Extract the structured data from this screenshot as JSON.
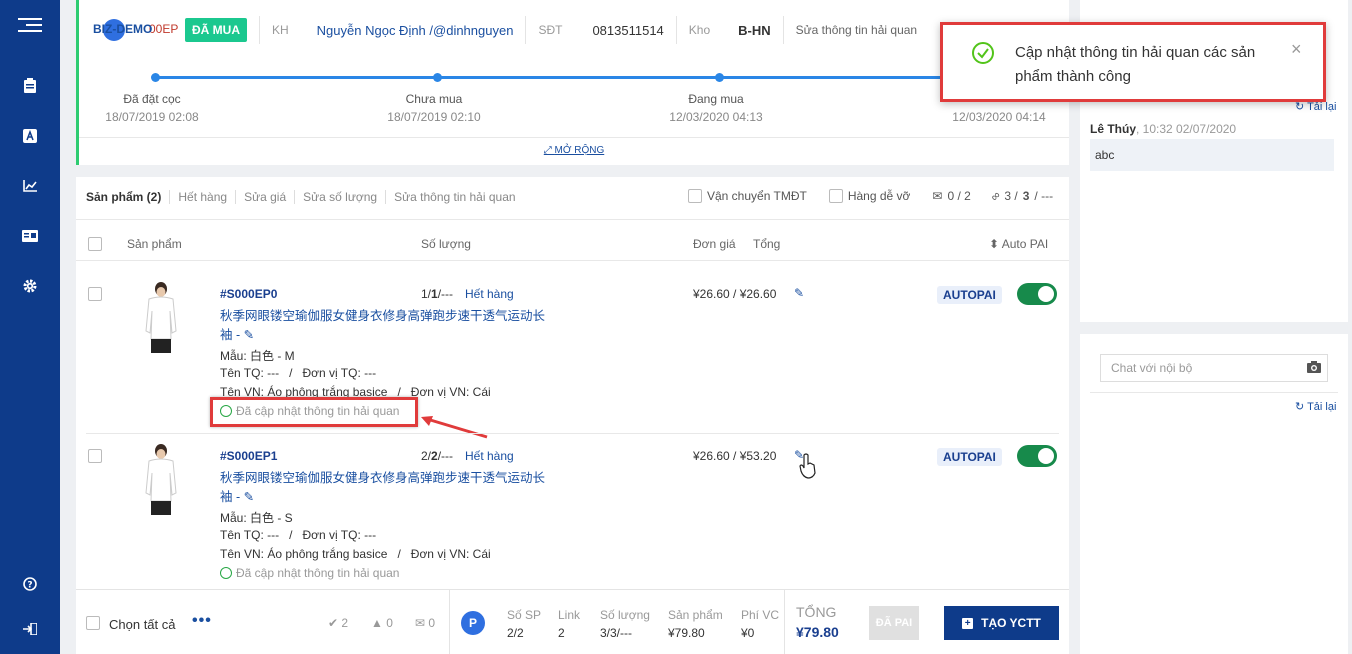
{
  "header": {
    "org_code": "BIZ-DEMO",
    "order_code": "00EP",
    "status": "ĐÃ MUA",
    "kh_label": "KH",
    "customer": "Nguyễn Ngọc Định /@dinhnguyen",
    "phone_label": "SĐT",
    "phone": "0813511514",
    "warehouse_label": "Kho",
    "warehouse": "B-HN",
    "customs_link": "Sửa thông tin hải quan",
    "timeline": [
      {
        "label": "Đã đặt cọc",
        "date": "18/07/2019 02:08"
      },
      {
        "label": "Chưa mua",
        "date": "18/07/2019 02:10"
      },
      {
        "label": "Đang mua",
        "date": "12/03/2020 04:13"
      },
      {
        "label": "",
        "date": "12/03/2020 04:14"
      }
    ],
    "expand": "MỞ RỘNG"
  },
  "products": {
    "tabs": [
      "Sản phẩm (2)",
      "Hết hàng",
      "Sửa giá",
      "Sửa số lượng",
      "Sửa thông tin hải quan"
    ],
    "tmdt": "Vận chuyển TMĐT",
    "fragile": "Hàng dễ vỡ",
    "mail_count": "0 / 2",
    "link_count_a": "3 /",
    "link_count_b": "3",
    "link_count_c": "/ ---",
    "columns": {
      "product": "Sản phẩm",
      "qty": "Số lượng",
      "price": "Đơn giá",
      "total": "Tổng",
      "auto": "Auto PAI"
    },
    "items": [
      {
        "code": "#S000EP0",
        "qty_a": "1/",
        "qty_b": "1",
        "qty_c": "/---",
        "stock": "Hết hàng",
        "name_l1": "秋季网眼镂空瑜伽服女健身衣修身高弹跑步速干透气运动长",
        "name_l2": "袖 -",
        "variant": "Mẫu: 白色 - M",
        "tq": "Tên TQ: ---   /   Đơn vị TQ: ---",
        "vn": "Tên VN: Áo phông trắng basice   /   Đơn vị VN: Cái",
        "customs": "Đã cập nhật thông tin hải quan",
        "price": "¥26.60 / ¥26.60",
        "auto": "AUTOPAI"
      },
      {
        "code": "#S000EP1",
        "qty_a": "2/",
        "qty_b": "2",
        "qty_c": "/---",
        "stock": "Hết hàng",
        "name_l1": "秋季网眼镂空瑜伽服女健身衣修身高弹跑步速干透气运动长",
        "name_l2": "袖 -",
        "variant": "Mẫu: 白色 - S",
        "tq": "Tên TQ: ---   /   Đơn vị TQ: ---",
        "vn": "Tên VN: Áo phông trắng basice   /   Đơn vị VN: Cái",
        "customs": "Đã cập nhật thông tin hải quan",
        "price": "¥26.60 / ¥53.20",
        "auto": "AUTOPAI"
      }
    ]
  },
  "footer": {
    "select_all": "Chọn tất cả",
    "ok_count": "2",
    "warn_count": "0",
    "mail_count": "0",
    "avatar": "P",
    "stats": [
      {
        "label": "Số SP",
        "value": "2/2"
      },
      {
        "label": "Link",
        "value": "2"
      },
      {
        "label": "Số lượng",
        "value": "3/3/---"
      },
      {
        "label": "Sản phẩm",
        "value": "¥79.80"
      },
      {
        "label": "Phí VC",
        "value": "¥0"
      }
    ],
    "total_label": "TỔNG",
    "total_value": "¥79.80",
    "paid_btn": "ĐÃ PAI",
    "create_btn": "TẠO YCTT"
  },
  "right": {
    "reload": "Tải lại",
    "comment_author": "Lê Thúy",
    "comment_time": ", 10:32 02/07/2020",
    "comment_text": "abc",
    "chat_placeholder": "Chat với nội bộ",
    "reload2": "Tải lại"
  },
  "toast": {
    "message_l1": "Cập nhật thông tin hải quan các sản",
    "message_l2": "phẩm thành công",
    "close": "×"
  },
  "colors": {
    "sidebar": "#0e3b8a",
    "accent": "#1a4fa0",
    "success": "#28a745",
    "highlight": "#e03b3b"
  }
}
